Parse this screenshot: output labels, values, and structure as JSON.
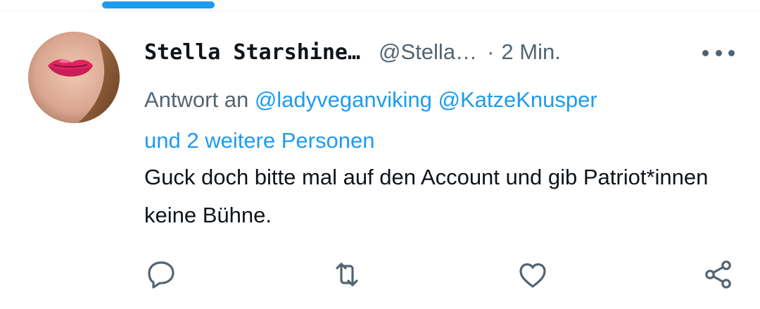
{
  "tweet": {
    "display_name": "Stella Starshine…",
    "handle": "@Stella…",
    "separator": "·",
    "timestamp": "2 Min.",
    "reply_prefix": "Antwort an",
    "mentions": [
      "@ladyveganviking",
      "@KatzeKnusper"
    ],
    "mentions_more": "und 2 weitere Personen",
    "text": "Guck doch bitte mal auf den Account und gib Patriot*innen keine Bühne."
  },
  "icons": {
    "more": "more-horizontal-icon",
    "reply": "reply-icon",
    "retweet": "retweet-icon",
    "like": "heart-icon",
    "share": "share-icon"
  },
  "colors": {
    "accent": "#1d9bf0",
    "secondary_text": "#536471",
    "primary_text": "#0f1419"
  }
}
